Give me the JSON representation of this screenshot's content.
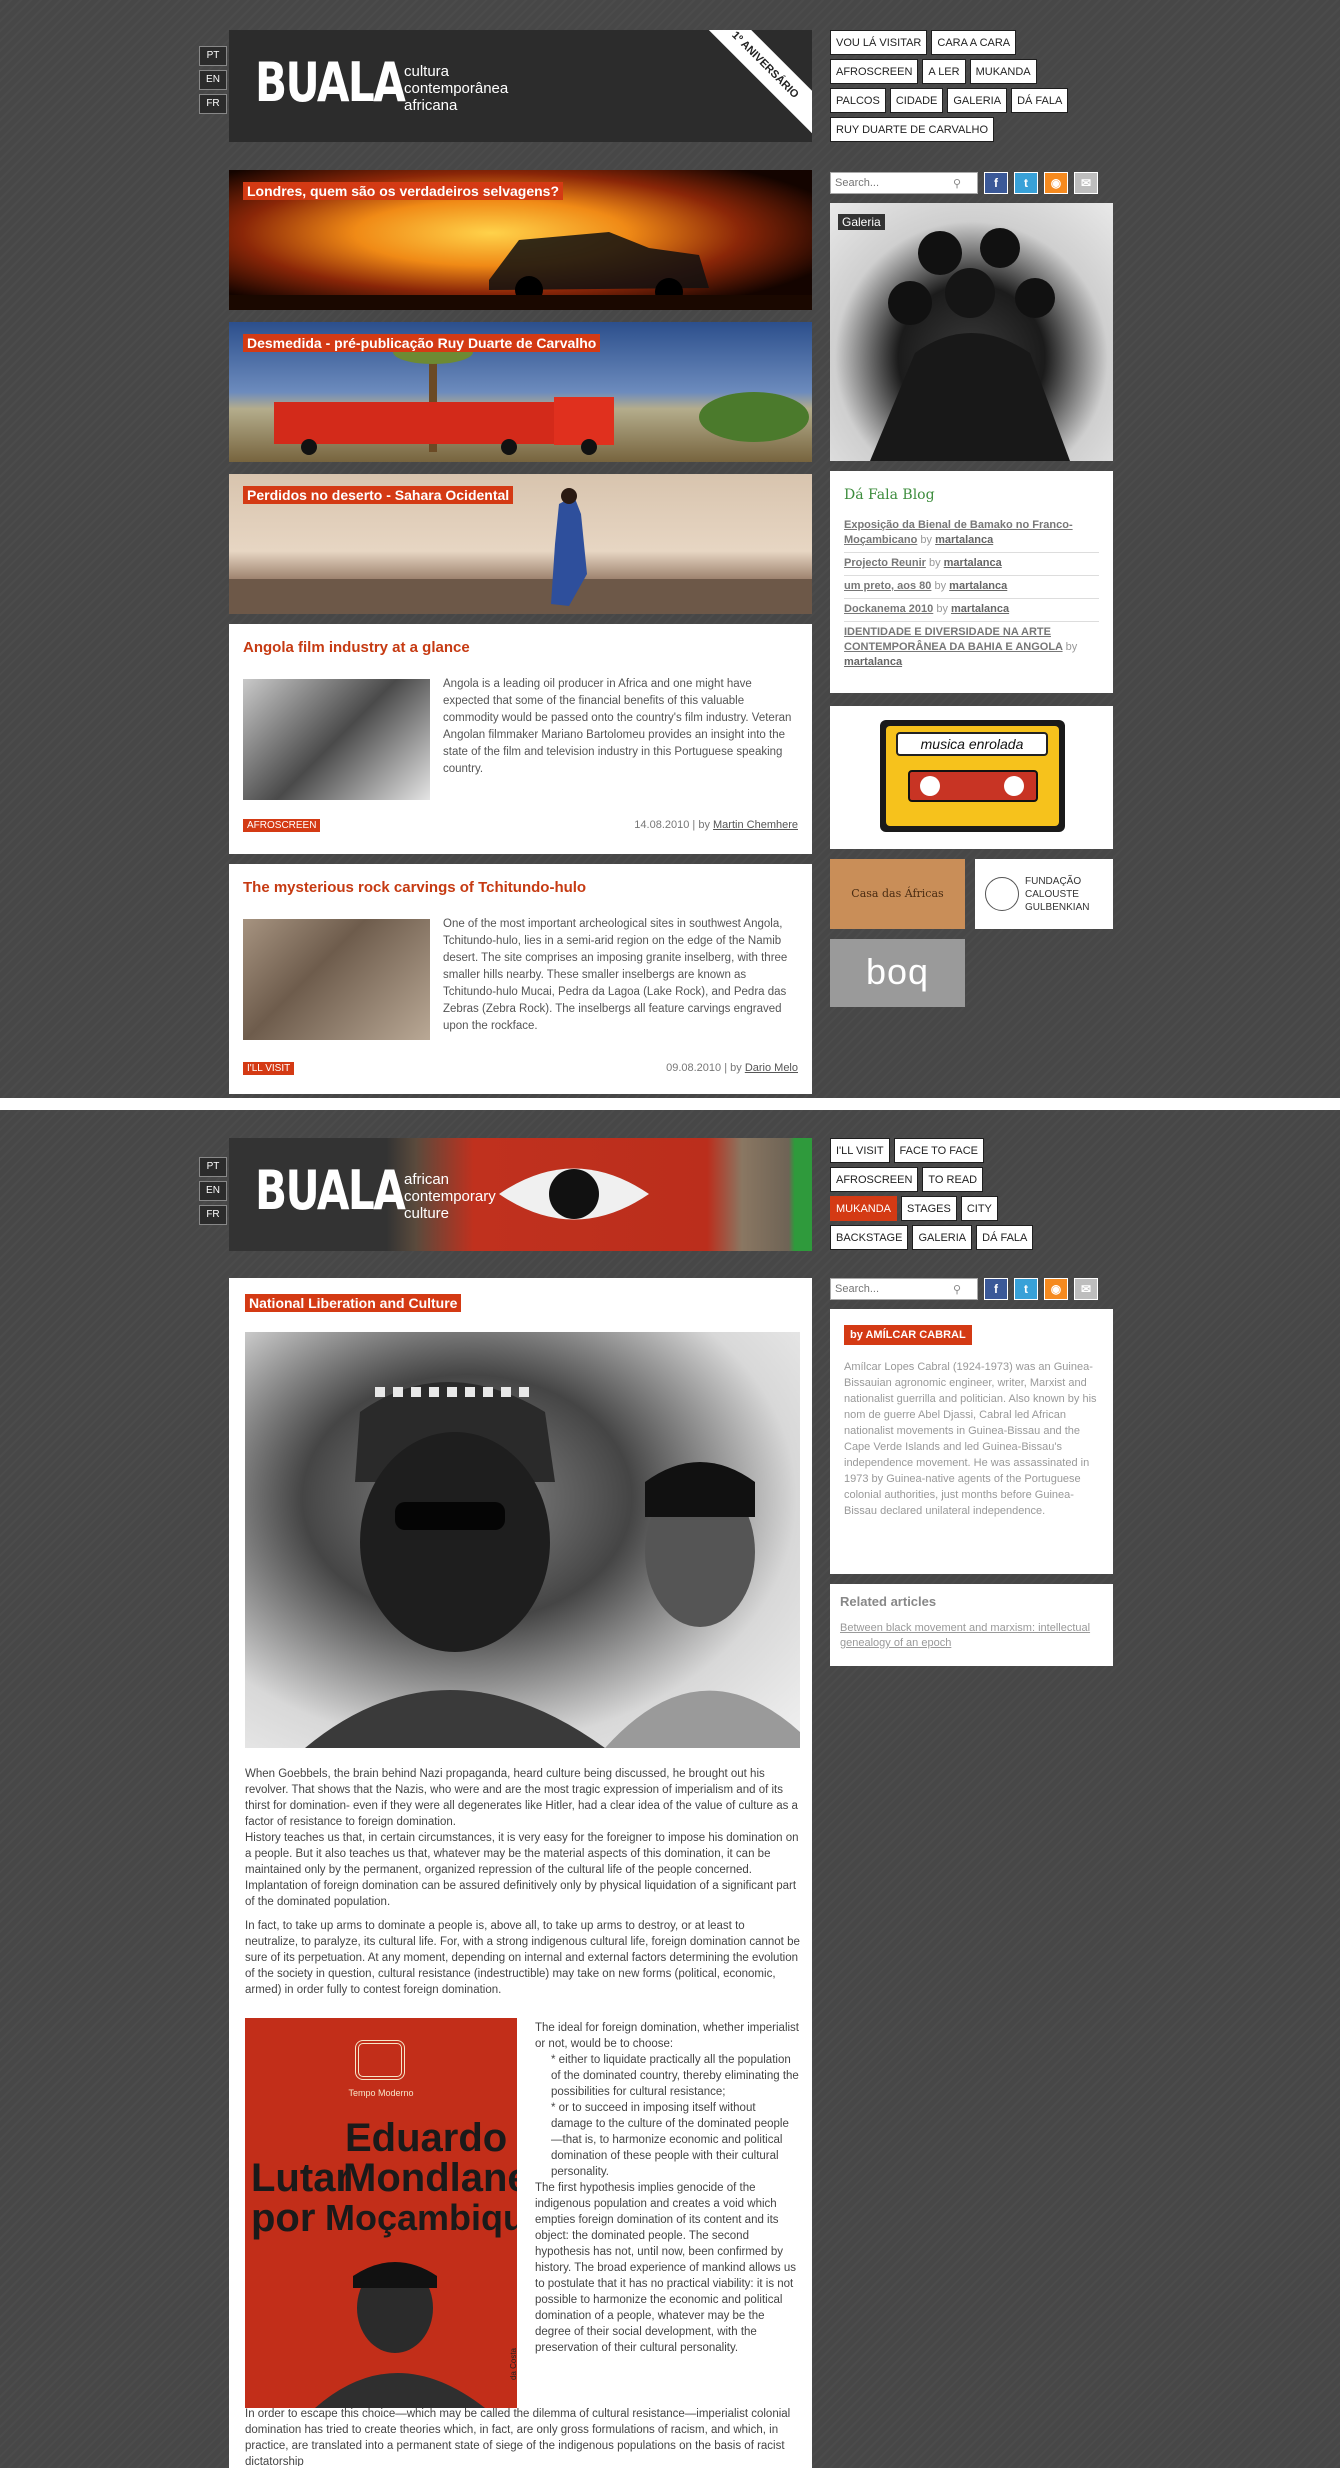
{
  "lang": [
    "PT",
    "EN",
    "FR"
  ],
  "shot1": {
    "logo": "BUALA",
    "tagline": [
      "cultura",
      "contemporânea",
      "africana"
    ],
    "anniversary": "1º ANIVERSÁRIO",
    "nav": [
      [
        "VOU LÁ VISITAR",
        "CARA A CARA"
      ],
      [
        "AFROSCREEN",
        "A LER",
        "MUKANDA"
      ],
      [
        "PALCOS",
        "CIDADE",
        "GALERIA",
        "DÁ FALA"
      ],
      [
        "RUY DUARTE DE CARVALHO"
      ]
    ],
    "search_placeholder": "Search...",
    "social": [
      "f",
      "t",
      "rss",
      "mail"
    ],
    "gallery_label": "Galeria",
    "features": [
      "Londres, quem são os verdadeiros selvagens?",
      "Desmedida - pré-publicação Ruy Duarte de Carvalho",
      "Perdidos no deserto - Sahara Ocidental"
    ],
    "articles": [
      {
        "title": "Angola film industry at a glance",
        "text": "Angola is a leading oil producer in Africa and one might have expected that some of the financial benefits of this valuable commodity would be passed onto the country's film industry. Veteran Angolan filmmaker Mariano Bartolomeu provides an insight into the state of the film and television industry in this Portuguese speaking country.",
        "category": "AFROSCREEN",
        "date": "14.08.2010 | by",
        "author": "Martin Chemhere"
      },
      {
        "title": "The mysterious rock carvings of Tchitundo-hulo",
        "text": "One of the most important archeological sites in southwest Angola, Tchitundo-hulo, lies in a semi-arid region on the edge of the Namib desert. The site comprises an imposing granite inselberg, with three smaller hills nearby. These smaller inselbergs are known as Tchitundo-hulo Mucai, Pedra da Lagoa (Lake Rock), and Pedra das Zebras (Zebra Rock). The inselbergs all feature carvings engraved upon the rockface.",
        "category": "I'LL VISIT",
        "date": "09.08.2010 | by",
        "author": "Dario Melo"
      }
    ],
    "blog": {
      "title": "Dá Fala Blog",
      "items": [
        {
          "t": "Exposição da Bienal de Bamako no Franco-Moçambicano",
          "a": "martalanca"
        },
        {
          "t": "Projecto Reunir",
          "a": "martalanca"
        },
        {
          "t": "um preto, aos 80",
          "a": "martalanca"
        },
        {
          "t": "Dockanema 2010",
          "a": "martalanca"
        },
        {
          "t": "IDENTIDADE E DIVERSIDADE NA ARTE CONTEMPORÂNEA DA BAHIA E ANGOLA",
          "a": "martalanca"
        }
      ],
      "by": "by"
    },
    "musica": "musica enrolada",
    "casa": "Casa das Áfricas",
    "gulbenkian": [
      "FUNDAÇÃO",
      "CALOUSTE",
      "GULBENKIAN"
    ],
    "boq": "boq"
  },
  "shot2": {
    "logo": "BUALA",
    "tagline": [
      "african",
      "contemporary",
      "culture"
    ],
    "nav": [
      [
        "I'LL VISIT",
        "FACE TO FACE"
      ],
      [
        "AFROSCREEN",
        "TO READ"
      ],
      [
        "MUKANDA",
        "STAGES",
        "CITY"
      ],
      [
        "BACKSTAGE",
        "GALERIA",
        "DÁ FALA"
      ]
    ],
    "search_placeholder": "Search...",
    "article_title": "National Liberation and Culture",
    "author_label": "by AMÍLCAR CABRAL",
    "bio": "Amílcar Lopes Cabral (1924-1973) was an Guinea-Bissauian agronomic engineer, writer, Marxist and nationalist guerrilla and politician. Also known by his nom de guerre Abel Djassi, Cabral led African nationalist movements in Guinea-Bissau and the Cape Verde Islands and led Guinea-Bissau's independence movement. He was assassinated in 1973 by Guinea-native agents of the Portuguese colonial authorities, just months before Guinea-Bissau declared unilateral independence.",
    "related_title": "Related articles",
    "related_link": "Between black movement and marxism: intellectual genealogy of an epoch",
    "para1": "When Goebbels, the brain behind Nazi propaganda, heard culture being discussed, he brought out his revolver. That shows that the Nazis, who were and are the most tragic expression of imperialism and of its thirst for domination- even if they were all degenerates like Hitler, had a clear idea of the value of culture as a factor of resistance to foreign domination.",
    "para2": "History teaches us that, in certain circumstances, it is very easy for the foreigner to impose his domination on a people. But it also teaches us that, whatever may be the material aspects of this domination, it can be maintained only by the permanent, organized repression of the cultural life of the people concerned. Implantation of foreign domination can be assured definitively only by physical liquidation of a significant part of the dominated population.",
    "para3": "In fact, to take up arms to dominate a people is, above all, to take up arms to destroy, or at least to neutralize, to paralyze, its cultural life. For, with a strong indigenous cultural life, foreign domination cannot be sure of its perpetuation. At any moment, depending on internal and external factors determining the evolution of the society in question, cultural resistance (indestructible) may take on new forms (political, economic, armed) in order fully to contest foreign domination.",
    "para4": "The ideal for foreign domination, whether imperialist or not, would be to choose:",
    "para5": "* either to liquidate practically all the population of the dominated country, thereby eliminating the possibilities for cultural resistance;",
    "para6": "* or to succeed in imposing itself without damage to the culture of the dominated people—that is, to harmonize economic and political domination of these people with their cultural personality.",
    "para7": "The first hypothesis implies genocide of the indigenous population and creates a void which empties foreign domination of its content and its object: the dominated people. The second hypothesis has not, until now, been confirmed by history. The broad experience of mankind allows us to postulate that it has no practical viability: it is not possible to harmonize the economic and political domination of a people, whatever may be the degree of their social development, with the preservation of their cultural personality.",
    "para8": "In order to escape this choice—which may be called the dilemma of cultural resistance—imperialist colonial domination has tried to create theories which, in fact, are only gross formulations of racism, and which, in practice, are translated into a permanent state of siege of the indigenous populations on the basis of racist dictatorship",
    "book": {
      "publisher": "Tempo Moderno",
      "line1": "Eduardo",
      "line2": "Lutar",
      "line3": "Mondlane",
      "line4": "por",
      "line5": "Moçambique",
      "credit": "da Costa"
    }
  }
}
